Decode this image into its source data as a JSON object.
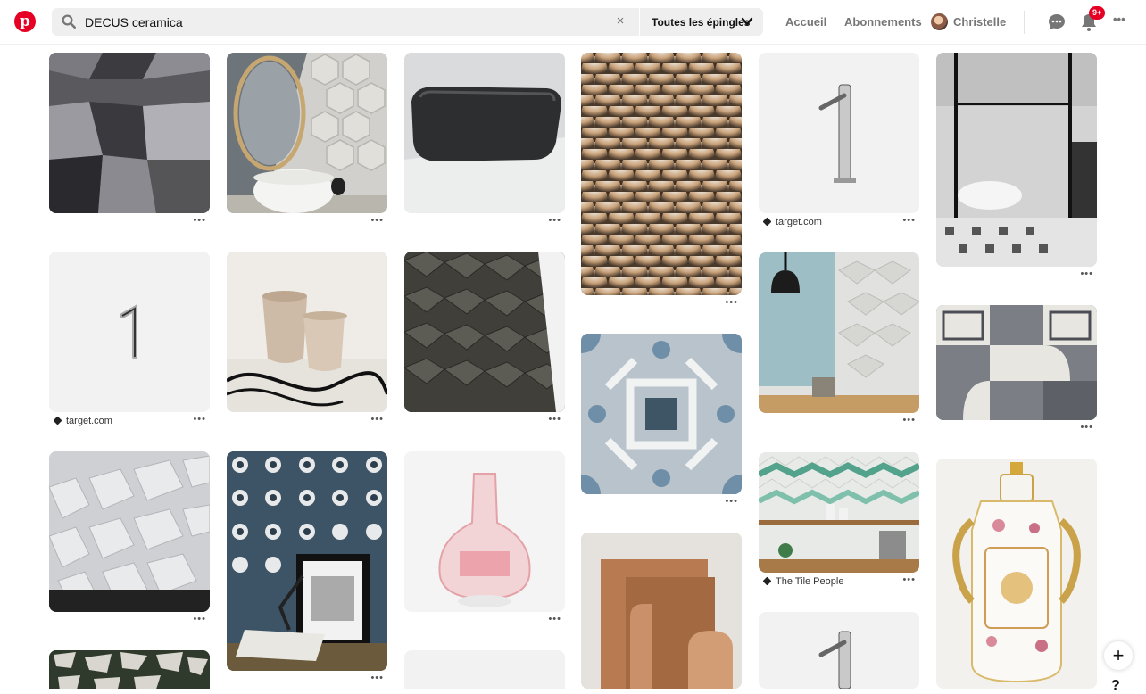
{
  "header": {
    "logo_letter": "p",
    "search": {
      "query": "DECUS ceramica",
      "clear": "×",
      "filter_label": "Toutes les épingles"
    },
    "nav": {
      "home": "Accueil",
      "following": "Abonnements"
    },
    "user": {
      "name": "Christelle"
    },
    "notifications_badge": "9+",
    "more": "•••"
  },
  "colors": {
    "brand": "#e60023",
    "search_bg": "#efefef",
    "muted_text": "#767676"
  },
  "pins": [
    {
      "subject": "grey 3D geometric tiles",
      "dots": "•••"
    },
    {
      "subject": "hexagon tiles with round mirror and basin",
      "dots": "•••"
    },
    {
      "subject": "black vessel sink",
      "dots": "•••"
    },
    {
      "subject": "fish-scale metallic tiles",
      "dots": "•••"
    },
    {
      "subject": "chrome tall faucet",
      "source": "target.com",
      "dots": "•••"
    },
    {
      "subject": "bathroom with freestanding tub",
      "dots": "•••"
    },
    {
      "subject": "chrome faucet",
      "source": "target.com",
      "dots": "•••"
    },
    {
      "subject": "ceramic pots",
      "dots": "•••"
    },
    {
      "subject": "dark 3D tiles",
      "dots": "•••"
    },
    {
      "subject": "blue patterned cement tile",
      "dots": "•••"
    },
    {
      "subject": "white 3D wall with lamp",
      "dots": "•••"
    },
    {
      "subject": "grey geometric tiles",
      "dots": "•••"
    },
    {
      "subject": "white 3D wall panels",
      "dots": "•••"
    },
    {
      "subject": "patterned tiles with framed photo",
      "dots": "•••"
    },
    {
      "subject": "pink glass carafe",
      "dots": "•••"
    },
    {
      "subject": "herringbone kitchen tiles",
      "source": "The Tile People",
      "dots": "•••"
    },
    {
      "subject": "terracotta arches",
      "dots": ""
    },
    {
      "subject": "chrome faucet",
      "dots": ""
    },
    {
      "subject": "porcelain vase",
      "dots": ""
    },
    {
      "subject": "terrazzo floor",
      "dots": ""
    },
    {
      "subject": "white blank",
      "dots": ""
    }
  ],
  "fab": {
    "plus": "+",
    "help": "?"
  }
}
